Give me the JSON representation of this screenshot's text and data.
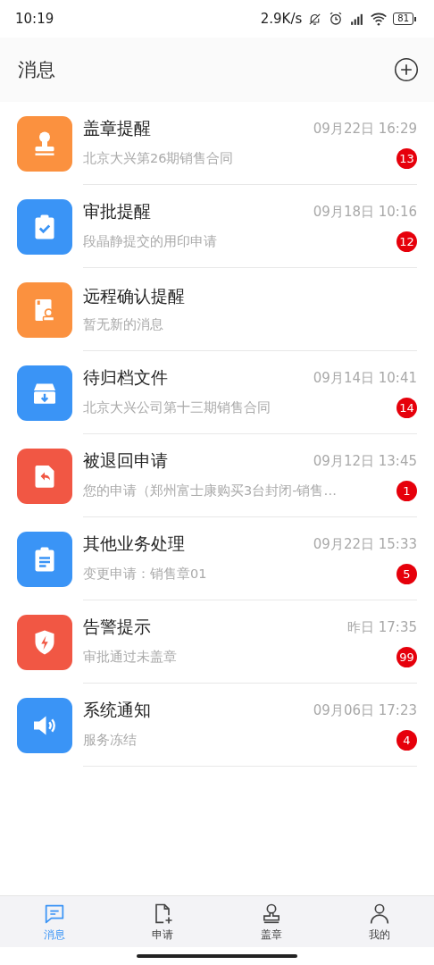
{
  "status_bar": {
    "time": "10:19",
    "speed": "2.9K/s",
    "battery": "81"
  },
  "header": {
    "title": "消息"
  },
  "messages": [
    {
      "title": "盖章提醒",
      "subtitle": "北京大兴第26期销售合同",
      "time": "09月22日 16:29",
      "badge": "13",
      "icon": {
        "kind": "stamp",
        "color": "#fb913f"
      }
    },
    {
      "title": "审批提醒",
      "subtitle": "段晶静提交的用印申请",
      "time": "09月18日 10:16",
      "badge": "12",
      "icon": {
        "kind": "check",
        "color": "#3a94f6"
      }
    },
    {
      "title": "远程确认提醒",
      "subtitle": "暂无新的消息",
      "icon": {
        "kind": "remote",
        "color": "#fb913f"
      }
    },
    {
      "title": "待归档文件",
      "subtitle": "北京大兴公司第十三期销售合同",
      "time": "09月14日 10:41",
      "badge": "14",
      "icon": {
        "kind": "archive",
        "color": "#3a94f6"
      }
    },
    {
      "title": "被退回申请",
      "subtitle": "您的申请（郑州富士康购买3台封闭-销售…",
      "time": "09月12日 13:45",
      "badge": "1",
      "icon": {
        "kind": "return",
        "color": "#f15744"
      }
    },
    {
      "title": "其他业务处理",
      "subtitle": "变更申请：销售章01",
      "time": "09月22日 15:33",
      "badge": "5",
      "icon": {
        "kind": "clipboard",
        "color": "#3a94f6"
      }
    },
    {
      "title": "告警提示",
      "subtitle": "审批通过未盖章",
      "time": "昨日 17:35",
      "badge": "99",
      "icon": {
        "kind": "alert",
        "color": "#f15744"
      }
    },
    {
      "title": "系统通知",
      "subtitle": "服务冻结",
      "time": "09月06日 17:23",
      "badge": "4",
      "icon": {
        "kind": "speaker",
        "color": "#3a94f6"
      }
    }
  ],
  "tabs": [
    {
      "label": "消息",
      "kind": "chat",
      "selected": true
    },
    {
      "label": "申请",
      "kind": "newdoc",
      "selected": false
    },
    {
      "label": "盖章",
      "kind": "stamp",
      "selected": false
    },
    {
      "label": "我的",
      "kind": "person",
      "selected": false
    }
  ]
}
